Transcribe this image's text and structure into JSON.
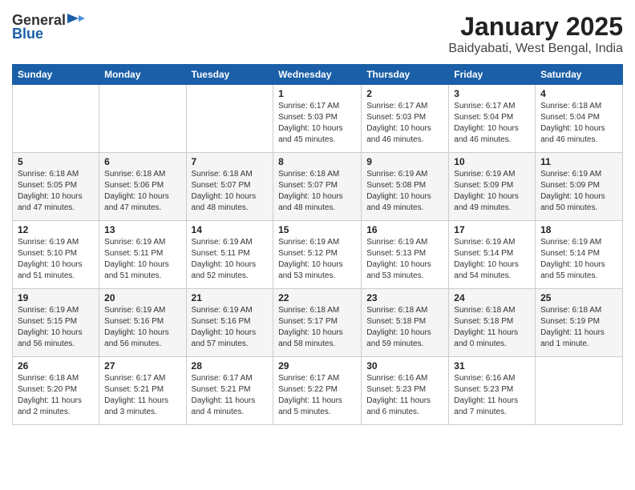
{
  "header": {
    "logo_general": "General",
    "logo_blue": "Blue",
    "title": "January 2025",
    "subtitle": "Baidyabati, West Bengal, India"
  },
  "weekdays": [
    "Sunday",
    "Monday",
    "Tuesday",
    "Wednesday",
    "Thursday",
    "Friday",
    "Saturday"
  ],
  "weeks": [
    [
      {
        "day": "",
        "info": ""
      },
      {
        "day": "",
        "info": ""
      },
      {
        "day": "",
        "info": ""
      },
      {
        "day": "1",
        "info": "Sunrise: 6:17 AM\nSunset: 5:03 PM\nDaylight: 10 hours\nand 45 minutes."
      },
      {
        "day": "2",
        "info": "Sunrise: 6:17 AM\nSunset: 5:03 PM\nDaylight: 10 hours\nand 46 minutes."
      },
      {
        "day": "3",
        "info": "Sunrise: 6:17 AM\nSunset: 5:04 PM\nDaylight: 10 hours\nand 46 minutes."
      },
      {
        "day": "4",
        "info": "Sunrise: 6:18 AM\nSunset: 5:04 PM\nDaylight: 10 hours\nand 46 minutes."
      }
    ],
    [
      {
        "day": "5",
        "info": "Sunrise: 6:18 AM\nSunset: 5:05 PM\nDaylight: 10 hours\nand 47 minutes."
      },
      {
        "day": "6",
        "info": "Sunrise: 6:18 AM\nSunset: 5:06 PM\nDaylight: 10 hours\nand 47 minutes."
      },
      {
        "day": "7",
        "info": "Sunrise: 6:18 AM\nSunset: 5:07 PM\nDaylight: 10 hours\nand 48 minutes."
      },
      {
        "day": "8",
        "info": "Sunrise: 6:18 AM\nSunset: 5:07 PM\nDaylight: 10 hours\nand 48 minutes."
      },
      {
        "day": "9",
        "info": "Sunrise: 6:19 AM\nSunset: 5:08 PM\nDaylight: 10 hours\nand 49 minutes."
      },
      {
        "day": "10",
        "info": "Sunrise: 6:19 AM\nSunset: 5:09 PM\nDaylight: 10 hours\nand 49 minutes."
      },
      {
        "day": "11",
        "info": "Sunrise: 6:19 AM\nSunset: 5:09 PM\nDaylight: 10 hours\nand 50 minutes."
      }
    ],
    [
      {
        "day": "12",
        "info": "Sunrise: 6:19 AM\nSunset: 5:10 PM\nDaylight: 10 hours\nand 51 minutes."
      },
      {
        "day": "13",
        "info": "Sunrise: 6:19 AM\nSunset: 5:11 PM\nDaylight: 10 hours\nand 51 minutes."
      },
      {
        "day": "14",
        "info": "Sunrise: 6:19 AM\nSunset: 5:11 PM\nDaylight: 10 hours\nand 52 minutes."
      },
      {
        "day": "15",
        "info": "Sunrise: 6:19 AM\nSunset: 5:12 PM\nDaylight: 10 hours\nand 53 minutes."
      },
      {
        "day": "16",
        "info": "Sunrise: 6:19 AM\nSunset: 5:13 PM\nDaylight: 10 hours\nand 53 minutes."
      },
      {
        "day": "17",
        "info": "Sunrise: 6:19 AM\nSunset: 5:14 PM\nDaylight: 10 hours\nand 54 minutes."
      },
      {
        "day": "18",
        "info": "Sunrise: 6:19 AM\nSunset: 5:14 PM\nDaylight: 10 hours\nand 55 minutes."
      }
    ],
    [
      {
        "day": "19",
        "info": "Sunrise: 6:19 AM\nSunset: 5:15 PM\nDaylight: 10 hours\nand 56 minutes."
      },
      {
        "day": "20",
        "info": "Sunrise: 6:19 AM\nSunset: 5:16 PM\nDaylight: 10 hours\nand 56 minutes."
      },
      {
        "day": "21",
        "info": "Sunrise: 6:19 AM\nSunset: 5:16 PM\nDaylight: 10 hours\nand 57 minutes."
      },
      {
        "day": "22",
        "info": "Sunrise: 6:18 AM\nSunset: 5:17 PM\nDaylight: 10 hours\nand 58 minutes."
      },
      {
        "day": "23",
        "info": "Sunrise: 6:18 AM\nSunset: 5:18 PM\nDaylight: 10 hours\nand 59 minutes."
      },
      {
        "day": "24",
        "info": "Sunrise: 6:18 AM\nSunset: 5:18 PM\nDaylight: 11 hours\nand 0 minutes."
      },
      {
        "day": "25",
        "info": "Sunrise: 6:18 AM\nSunset: 5:19 PM\nDaylight: 11 hours\nand 1 minute."
      }
    ],
    [
      {
        "day": "26",
        "info": "Sunrise: 6:18 AM\nSunset: 5:20 PM\nDaylight: 11 hours\nand 2 minutes."
      },
      {
        "day": "27",
        "info": "Sunrise: 6:17 AM\nSunset: 5:21 PM\nDaylight: 11 hours\nand 3 minutes."
      },
      {
        "day": "28",
        "info": "Sunrise: 6:17 AM\nSunset: 5:21 PM\nDaylight: 11 hours\nand 4 minutes."
      },
      {
        "day": "29",
        "info": "Sunrise: 6:17 AM\nSunset: 5:22 PM\nDaylight: 11 hours\nand 5 minutes."
      },
      {
        "day": "30",
        "info": "Sunrise: 6:16 AM\nSunset: 5:23 PM\nDaylight: 11 hours\nand 6 minutes."
      },
      {
        "day": "31",
        "info": "Sunrise: 6:16 AM\nSunset: 5:23 PM\nDaylight: 11 hours\nand 7 minutes."
      },
      {
        "day": "",
        "info": ""
      }
    ]
  ]
}
